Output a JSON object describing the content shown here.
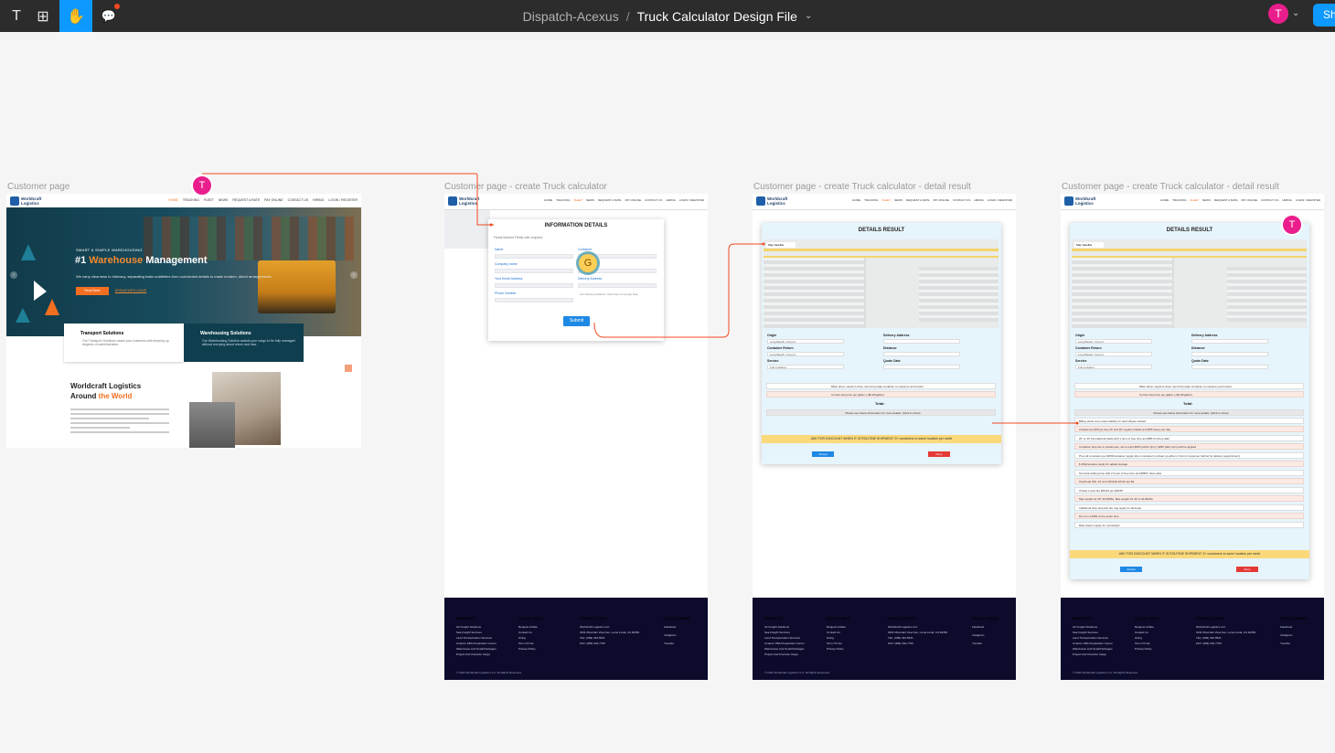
{
  "toolbar": {
    "tools": [
      {
        "name": "text-tool",
        "glyph": "T"
      },
      {
        "name": "components-tool",
        "glyph": "⊞"
      },
      {
        "name": "hand-tool",
        "glyph": "✋"
      },
      {
        "name": "comment-tool",
        "glyph": "💬"
      }
    ],
    "project": "Dispatch-Acexus",
    "separator": "/",
    "file": "Truck Calculator Design File",
    "avatar_initial": "T",
    "share_label": "Sha",
    "colors": {
      "bar": "#2c2c2c",
      "accent": "#0d99ff",
      "avatar": "#e91e8c"
    }
  },
  "frames": {
    "customer": {
      "label": "Customer page"
    },
    "calculator": {
      "label": "Customer page - create Truck calculator"
    },
    "result1": {
      "label": "Customer page - create Truck calculator - detail result"
    },
    "result2": {
      "label": "Customer page - create Truck calculator - detail result"
    }
  },
  "site": {
    "logo": {
      "line1": "Worldcraft",
      "line2": "Logistics"
    },
    "nav_customer": [
      "HOME",
      "TRACKING",
      "FLEET",
      "NEWS",
      "REQUEST A RATE",
      "PAY ONLINE",
      "CONTACT US",
      "HIRING",
      "LOGIN / REGISTER"
    ],
    "nav_frames": [
      "HOME",
      "TRACKING",
      "FLEET",
      "NEWS",
      "REQUEST A RATE",
      "PAY ONLINE",
      "CONTACT US",
      "HIRING",
      "LOGIN / REGISTER"
    ]
  },
  "hero": {
    "kicker": "SMART & SIMPLE WAREHOUSING",
    "title_pre": "#1 ",
    "title_hl": "Warehouse",
    "title_post": " Management",
    "subtitle": "We carry clearness to intricacy, separating basic subtleties from convoluted details to make modern, direct arrangements.",
    "btn_primary": "Read More",
    "btn_secondary": "DREAM WITH LEAVE"
  },
  "cards": [
    {
      "title": "Transport Solutions",
      "desc": "Our Transport Solutions assist your business with keeping up degrees of administration."
    },
    {
      "title": "Warehousing Solutions",
      "desc": "Our Warehousing Solution assists your cargo to be fully managed without worrying about return and loss."
    }
  ],
  "about": {
    "line1": "Worldcraft Logistics",
    "line2_pre": "Around ",
    "line2_hl": "the World"
  },
  "form": {
    "title": "INFORMATION DETAILS",
    "hint": "Fields Marked Fields with required",
    "labels": [
      "Name",
      "Company name",
      "Your Email Address",
      "Phone Number",
      "Delivery Address",
      "Container"
    ],
    "note": "Get Delivery Address: Click here to Google Map",
    "submit": "Submit"
  },
  "result": {
    "title": "DETAILS RESULT",
    "map_tabs": "Map  Satellite",
    "origin_label": "Origin",
    "origin_value": "Long Beach, CA port",
    "container_return_label": "Container Return",
    "container_return_value": "Long Beach, CA port",
    "service_label": "Service",
    "service_value": "Full container",
    "delivery_label": "Delivery Address",
    "distance_label": "Distance",
    "quote_label": "Quote Date",
    "row1": "Miles driver needs to drive round trip (take container to customer and return)",
    "row2": "Current fuel price per gallon (~$6.20/gallon)",
    "total_label": "Total:",
    "info_row": "Please see below information for more details: (Click to show)",
    "details": [
      "Billing starts once responsibility for said shipper started",
      "Chassis fee $45 per day 20' and 40' regular chassis and $55 heavy per day",
      "20' or 40' international loads with 1 hour of free time and $85 /hr there after",
      "Container drop fee to warehouse, we're extra $250 (within 2pm), $350 (after 2pm) will be applied",
      "Pre pull to location per $250/container (apply when container is picked up either in front of customer behind for delivery appointment)",
      "$ 350/container apply for added storage",
      "Terminal waiting time with 2 hours of free time and $85/hr there after",
      "Overhead 20ft, 40' and 40'OHD 40'HC are $0",
      "Chassi 3 axel fee $25/10 per $40/87",
      "Max weight for 20' 43,000lbs. Max weight for 40' is 44,000lbs",
      "Additional drop and pick fee may apply for all areas",
      "Dry run is $350 at the quote time",
      "Rate doesn't apply for overweight"
    ],
    "discount": "ASK FOR DISCOUNT WHEN IT IS ROUTINE SHIPMENT: 3+ containers to same location per week",
    "accept": "Accept",
    "deny": "Deny"
  },
  "footer": {
    "headings": [
      "SERVICES",
      "QUICK LINKS",
      "CONTACT INFO",
      "SOCIAL MEDIA"
    ],
    "services": [
      "Air Freight Solutions",
      "Sea Freight Services",
      "Land Transportation Services",
      "Amazon FBA Preparation Center",
      "Warehouse And Small Packages",
      "Project And Oversize Cargo"
    ],
    "links": [
      "Request A Rate",
      "Contact Us",
      "Hiring",
      "Term Of Use",
      "Privacy Policy"
    ],
    "contact": [
      "Worldcraft Logistics LLC",
      "3041 Mountain View Ave, Loma Linda, CA 92354",
      "TEL: (909) 332-5521",
      "FAX: (909) 332-7700"
    ],
    "social": [
      "Facebook",
      "Instagram",
      "Youtube"
    ],
    "copyright": "© 2022 Worldcraft Logistics LLC. All Rights Reserved."
  },
  "cursors": {
    "collab_initial": "G",
    "user_initial": "T"
  }
}
